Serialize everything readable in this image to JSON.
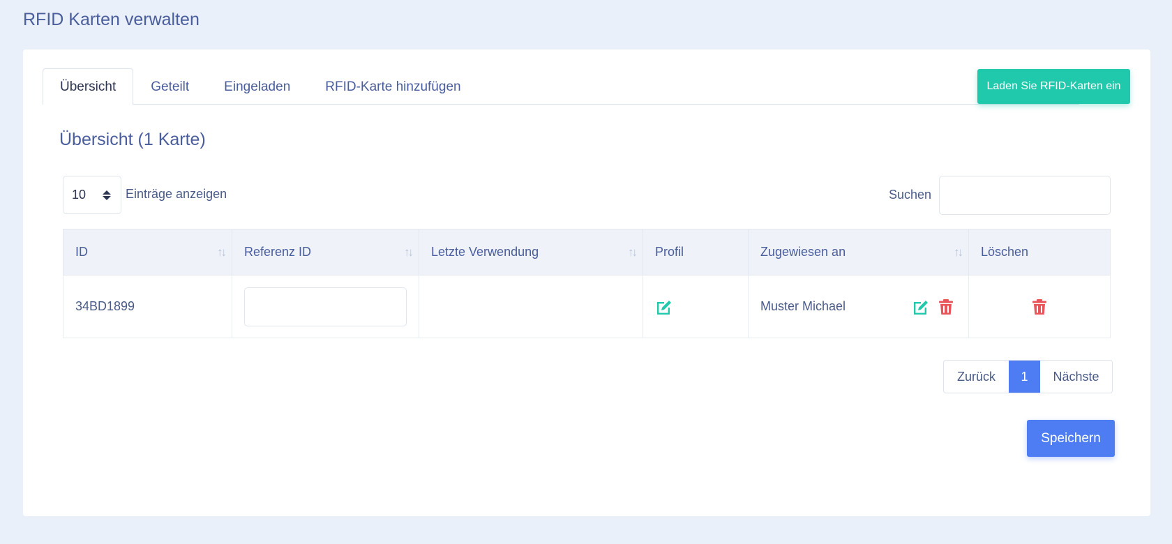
{
  "page": {
    "title": "RFID Karten verwalten"
  },
  "tabs": [
    {
      "label": "Übersicht",
      "active": true
    },
    {
      "label": "Geteilt",
      "active": false
    },
    {
      "label": "Eingeladen",
      "active": false
    },
    {
      "label": "RFID-Karte hinzufügen",
      "active": false
    }
  ],
  "actions": {
    "load_label": "Laden Sie RFID-Karten ein",
    "save_label": "Speichern"
  },
  "overview": {
    "title": "Übersicht (1 Karte)"
  },
  "controls": {
    "length_value": "10",
    "length_label": "Einträge anzeigen",
    "search_label": "Suchen",
    "search_value": ""
  },
  "table": {
    "columns": [
      {
        "label": "ID",
        "sortable": true
      },
      {
        "label": "Referenz ID",
        "sortable": true
      },
      {
        "label": "Letzte Verwendung",
        "sortable": true
      },
      {
        "label": "Profil",
        "sortable": false
      },
      {
        "label": "Zugewiesen an",
        "sortable": true
      },
      {
        "label": "Löschen",
        "sortable": false
      }
    ],
    "rows": [
      {
        "id": "34BD1899",
        "reference_id": "",
        "last_used": "",
        "assigned_to": "Muster Michael"
      }
    ]
  },
  "pagination": {
    "prev_label": "Zurück",
    "current_page": "1",
    "next_label": "Nächste"
  },
  "icons": {
    "edit": "edit-icon",
    "delete": "trash-icon",
    "sort": "sort-icon"
  },
  "colors": {
    "accent_teal": "#20c9ab",
    "primary_blue": "#4e7df3",
    "danger_red": "#e8545a"
  }
}
